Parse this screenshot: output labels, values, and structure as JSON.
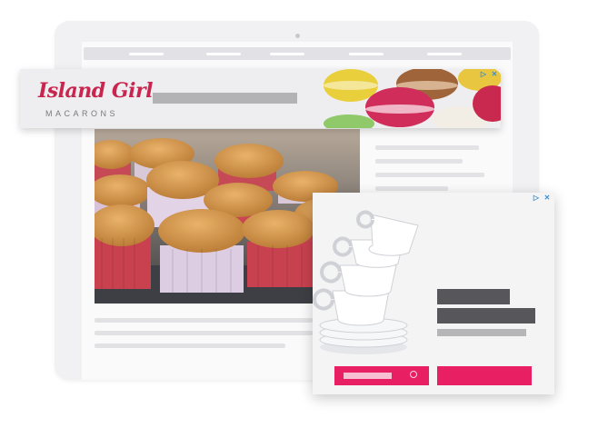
{
  "banner_ad": {
    "brand_name": "Island Girl",
    "brand_tagline": "MACARONS",
    "ad_choices_icon": "ad-choices-icon",
    "close_icon": "close-icon"
  },
  "popup_ad": {
    "ad_choices_icon": "ad-choices-icon",
    "close_icon": "close-icon"
  },
  "colors": {
    "brand": "#c8264e",
    "cta": "#e81f63",
    "adchoices": "#3c8fd0"
  }
}
